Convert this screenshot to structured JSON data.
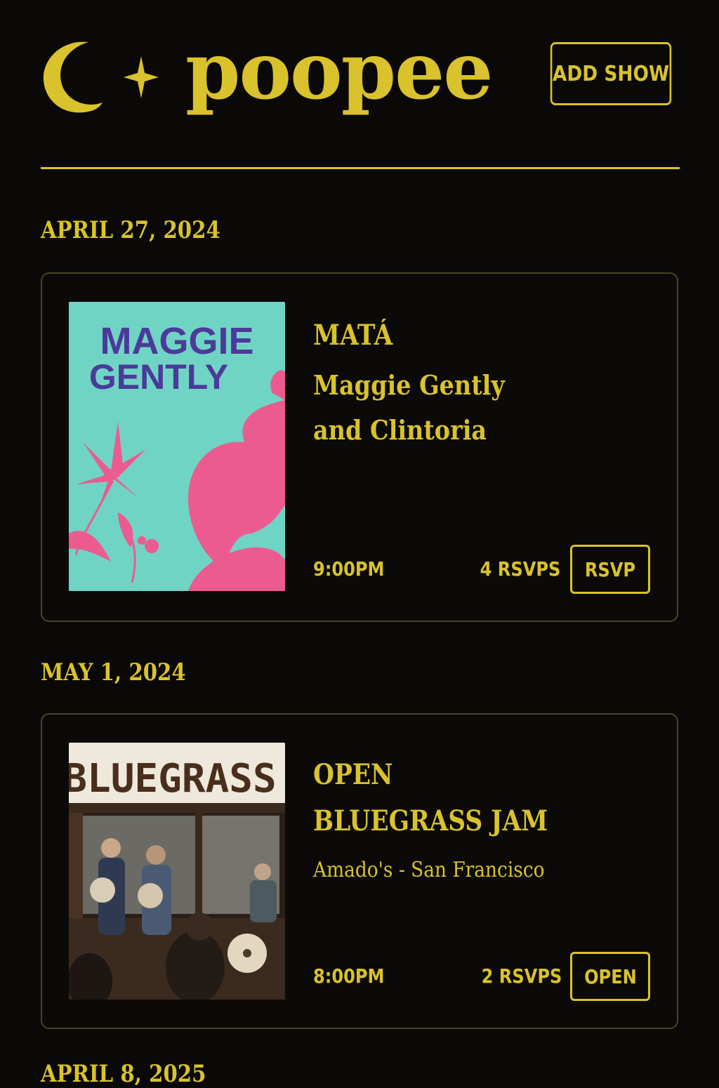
{
  "header": {
    "logo_text": "poopee",
    "add_show_label": "ADD SHOW"
  },
  "colors": {
    "background": "#0a0908",
    "accent": "#d9c22c",
    "card_border": "#4a4428"
  },
  "shows": [
    {
      "date": "APRIL 27, 2024",
      "poster_text_line1": "MAGGIE",
      "poster_text_line2": "GENTLY",
      "title_lines": [
        "MATÁ"
      ],
      "subtitle_lines": [
        "Maggie Gently",
        "and Clintoria"
      ],
      "time": "9:00PM",
      "rsvps": "4 RSVPS",
      "action_label": "RSVP"
    },
    {
      "date": "MAY 1, 2024",
      "poster_text_line1": "BLUEGRASS",
      "title_lines": [
        "OPEN",
        "BLUEGRASS JAM"
      ],
      "subtitle_lines": [
        "Amado's - San Francisco"
      ],
      "time": "8:00PM",
      "rsvps": "2 RSVPS",
      "action_label": "OPEN"
    },
    {
      "date": "APRIL 8, 2025"
    }
  ]
}
